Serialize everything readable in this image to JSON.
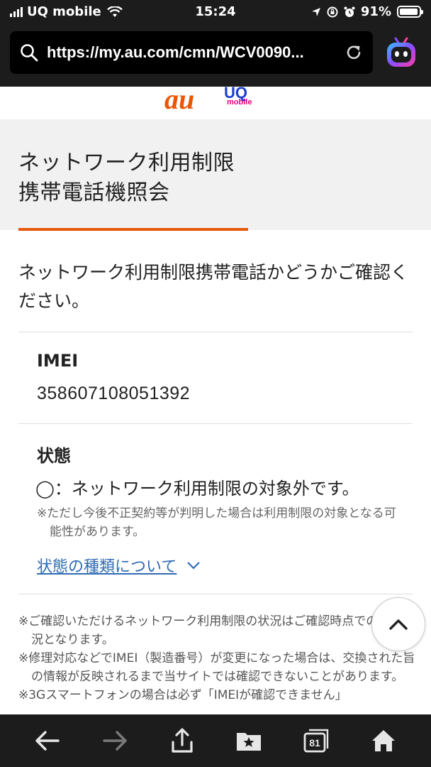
{
  "status_bar": {
    "carrier": "UQ mobile",
    "time": "15:24",
    "battery": "91%"
  },
  "browser": {
    "url": "https://my.au.com/cmn/WCV0090..."
  },
  "header": {
    "brand_au": "au",
    "brand_uq": "UQ",
    "brand_uq_sub": "mobile"
  },
  "page": {
    "title_line1": "ネットワーク利用制限",
    "title_line2": "携帯電話機照会",
    "intro": "ネットワーク利用制限携帯電話かどうかご確認ください。",
    "imei_label": "IMEI",
    "imei_value": "358607108051392",
    "status_label": "状態",
    "status_value": "◯：ネットワーク利用制限の対象外です。",
    "status_note": "※ただし今後不正契約等が判明した場合は利用制限の対象となる可能性があります。",
    "status_link": "状態の種類について"
  },
  "footnotes": [
    "※ご確認いただけるネットワーク利用制限の状況はご確認時点での登録状況となります。",
    "※修理対応などでIMEI（製造番号）が変更になった場合は、交換された旨の情報が反映されるまで当サイトでは確認できないことがあります。",
    "※3Gスマートフォンの場合は必ず「IMEIが確認できません」"
  ],
  "toolbar": {
    "tabs_count": "81"
  },
  "colors": {
    "accent": "#e8580c",
    "link": "#2e6bb5",
    "chrome": "#1c1c1c"
  }
}
